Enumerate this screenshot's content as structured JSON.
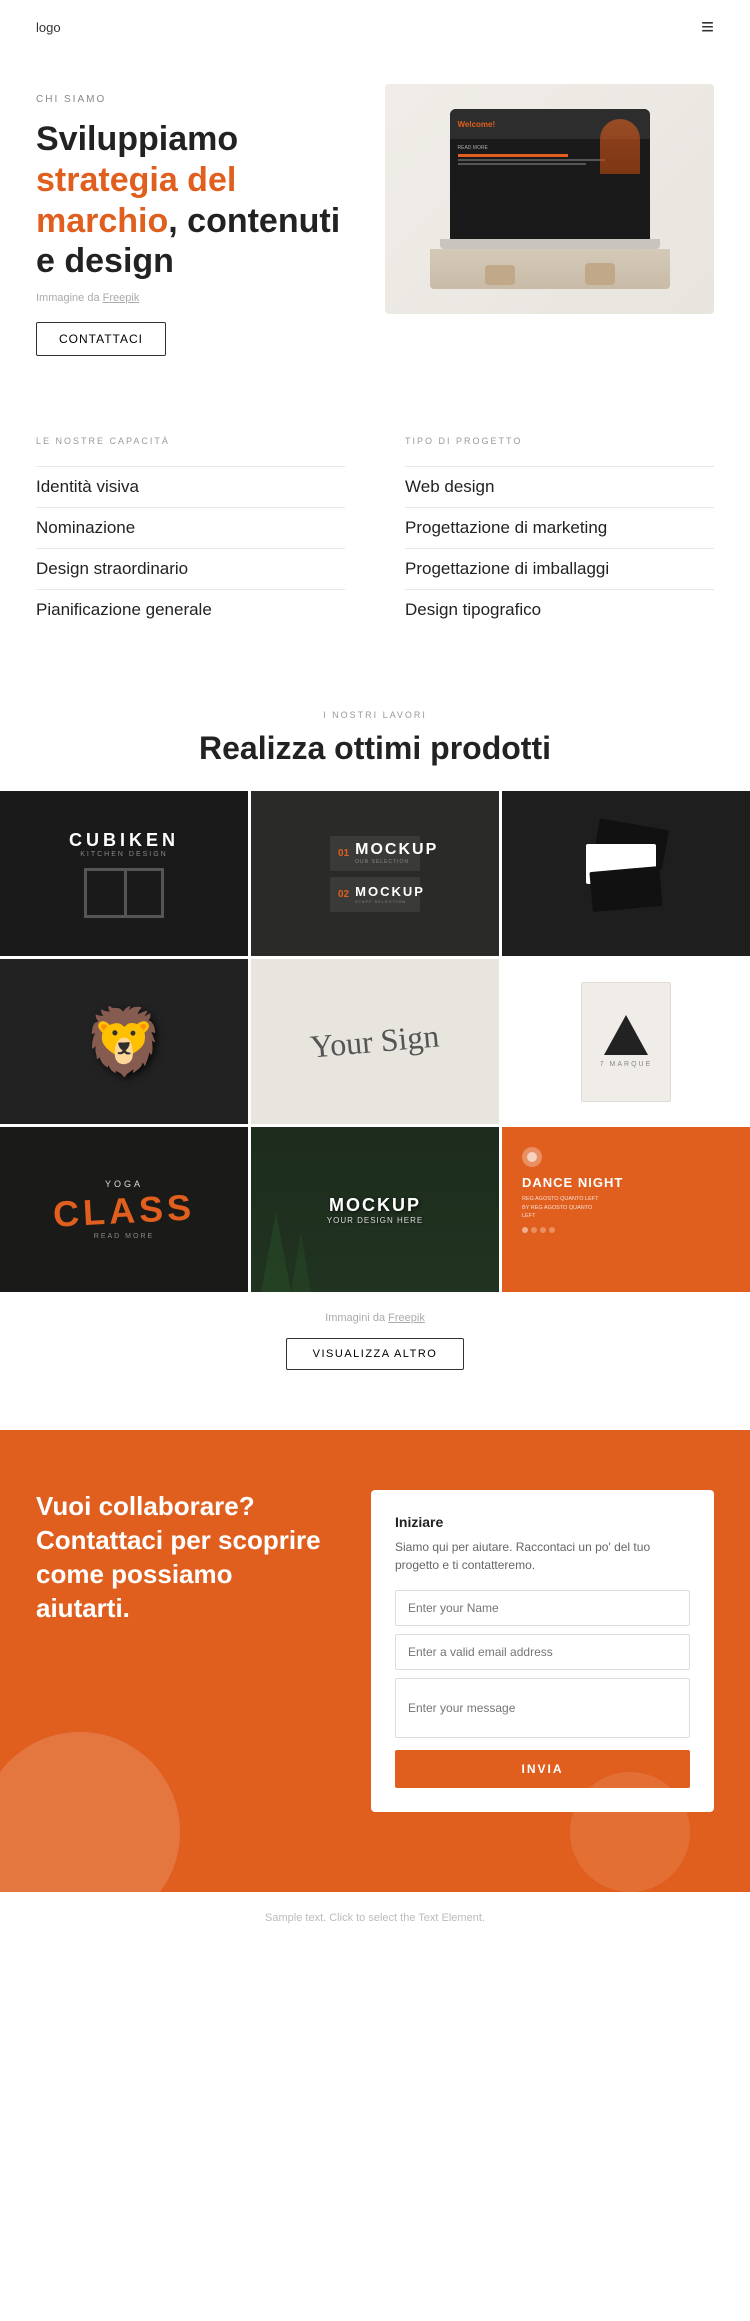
{
  "header": {
    "logo": "logo",
    "menu_icon": "≡"
  },
  "hero": {
    "label": "CHI SIAMO",
    "title_line1": "Sviluppiamo ",
    "title_accent": "strategia del marchio",
    "title_line2": ", contenuti e design",
    "image_credit_prefix": "Immagine da ",
    "image_credit_link": "Freepik",
    "contact_button": "CONTATTACI"
  },
  "capabilities": {
    "col1_label": "LE NOSTRE CAPACITÀ",
    "col1_items": [
      "Identità visiva",
      "Nominazione",
      "Design straordinario",
      "Pianificazione generale"
    ],
    "col2_label": "TIPO DI PROGETTO",
    "col2_items": [
      "Web design",
      "Progettazione di marketing",
      "Progettazione di imballaggi",
      "Design tipografico"
    ]
  },
  "portfolio": {
    "label": "I NOSTRI LAVORI",
    "title": "Realizza ottimi prodotti",
    "image_credit_prefix": "Immagini da ",
    "image_credit_link": "Freepik",
    "view_more_button": "VISUALIZZA ALTRO"
  },
  "cta": {
    "title": "Vuoi collaborare? Contattaci per scoprire come possiamo aiutarti.",
    "form_title": "Iniziare",
    "form_desc": "Siamo qui per aiutare. Raccontaci un po' del tuo progetto e ti contatteremo.",
    "name_placeholder": "Enter your Name",
    "email_placeholder": "Enter a valid email address",
    "message_placeholder": "Enter your message",
    "submit_button": "INVIA"
  },
  "footer": {
    "text": "Sample text. Click to select the Text Element."
  },
  "yoga_text": "CLASS",
  "mockup_text": "MOCKUP",
  "mockup_sub": "YOUR DESIGN HERE",
  "dance_title": "DANCE NIGHT",
  "dance_sub": "REG AGOSTO QUANTO LEFT BY REG AGOSTO QUANTO LEFT"
}
